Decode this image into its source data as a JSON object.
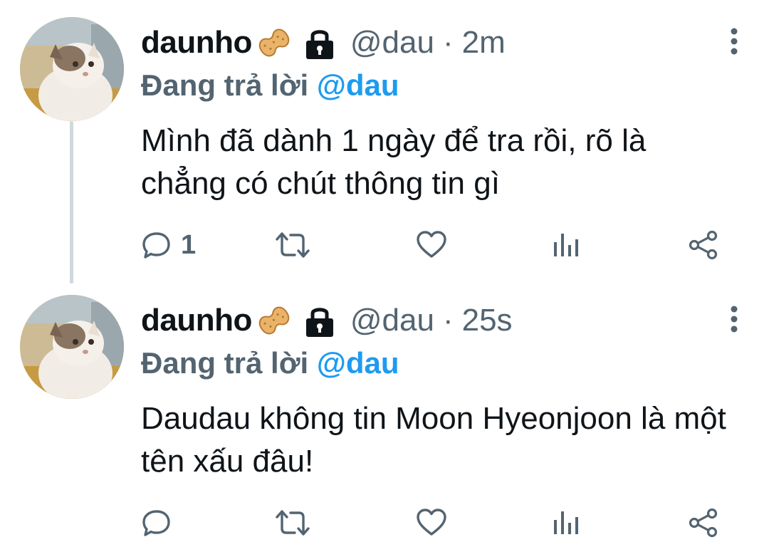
{
  "colors": {
    "text_primary": "#0f1419",
    "text_secondary": "#536471",
    "accent_blue": "#1d9bf0",
    "thread_line": "#cfd9de"
  },
  "tweets": [
    {
      "display_name": "daunho",
      "name_emoji_icon": "peanut-icon",
      "protected_icon": "lock-icon",
      "handle": "@dau",
      "separator": "·",
      "time": "2m",
      "reply_prefix": "Đang trả lời",
      "reply_mention": "@dau",
      "text": "Mình đã dành 1 ngày để tra rồi, rõ là chẳng có chút thông tin gì",
      "reply_count": "1",
      "actions": [
        "reply-icon",
        "retweet-icon",
        "heart-icon",
        "views-icon",
        "share-icon"
      ]
    },
    {
      "display_name": "daunho",
      "name_emoji_icon": "peanut-icon",
      "protected_icon": "lock-icon",
      "handle": "@dau",
      "separator": "·",
      "time": "25s",
      "reply_prefix": "Đang trả lời",
      "reply_mention": "@dau",
      "text": "Daudau không tin Moon Hyeonjoon là một tên xấu đâu!",
      "reply_count": "",
      "actions": [
        "reply-icon",
        "retweet-icon",
        "heart-icon",
        "views-icon",
        "share-icon"
      ]
    }
  ]
}
